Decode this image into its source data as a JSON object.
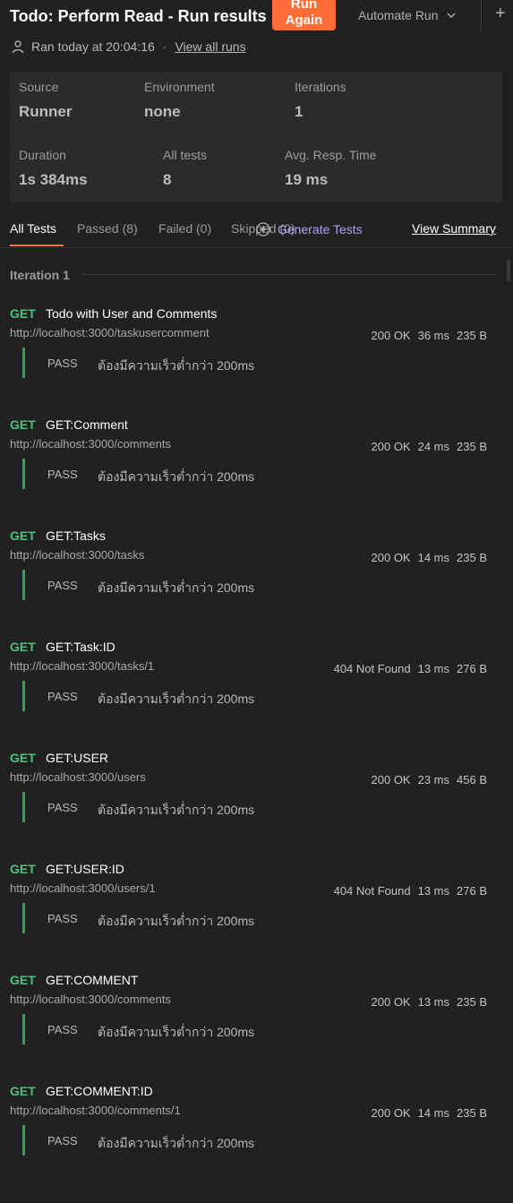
{
  "header": {
    "title": "Todo: Perform Read - Run results",
    "run_again_label": "Run\nAgain",
    "automate_label": "Automate Run",
    "ran_at": "Ran today at 20:04:16",
    "separator": "·",
    "view_all_runs": "View all runs",
    "plus": "+"
  },
  "summary": {
    "source_label": "Source",
    "source_value": "Runner",
    "environment_label": "Environment",
    "environment_value": "none",
    "iterations_label": "Iterations",
    "iterations_value": "1",
    "duration_label": "Duration",
    "duration_value": "1s 384ms",
    "all_tests_label": "All tests",
    "all_tests_value": "8",
    "avg_label": "Avg. Resp. Time",
    "avg_value": "19 ms"
  },
  "tabs": {
    "all": "All Tests",
    "passed": "Passed (8)",
    "failed": "Failed (0)",
    "skipped": "Skipped (0)",
    "generate": "Generate Tests",
    "view_summary": "View Summary"
  },
  "iteration_label": "Iteration 1",
  "colors": {
    "accent": "#ff6c37",
    "get": "#44c77c",
    "pass_bar": "#2da44e",
    "generate": "#b89cf5"
  },
  "requests": [
    {
      "method": "GET",
      "name": "Todo with User and Comments",
      "url": "http://localhost:3000/taskusercomment",
      "status": "200 OK",
      "time": "36 ms",
      "size": "235 B",
      "test_status": "PASS",
      "test_name": "ต้องมีความเร็วต่ำกว่า 200ms"
    },
    {
      "method": "GET",
      "name": "GET:Comment",
      "url": "http://localhost:3000/comments",
      "status": "200 OK",
      "time": "24 ms",
      "size": "235 B",
      "test_status": "PASS",
      "test_name": "ต้องมีความเร็วต่ำกว่า 200ms"
    },
    {
      "method": "GET",
      "name": "GET:Tasks",
      "url": "http://localhost:3000/tasks",
      "status": "200 OK",
      "time": "14 ms",
      "size": "235 B",
      "test_status": "PASS",
      "test_name": "ต้องมีความเร็วต่ำกว่า 200ms"
    },
    {
      "method": "GET",
      "name": "GET:Task:ID",
      "url": "http://localhost:3000/tasks/1",
      "status": "404 Not Found",
      "time": "13 ms",
      "size": "276 B",
      "test_status": "PASS",
      "test_name": "ต้องมีความเร็วต่ำกว่า 200ms"
    },
    {
      "method": "GET",
      "name": "GET:USER",
      "url": "http://localhost:3000/users",
      "status": "200 OK",
      "time": "23 ms",
      "size": "456 B",
      "test_status": "PASS",
      "test_name": "ต้องมีความเร็วต่ำกว่า 200ms"
    },
    {
      "method": "GET",
      "name": "GET:USER:ID",
      "url": "http://localhost:3000/users/1",
      "status": "404 Not Found",
      "time": "13 ms",
      "size": "276 B",
      "test_status": "PASS",
      "test_name": "ต้องมีความเร็วต่ำกว่า 200ms"
    },
    {
      "method": "GET",
      "name": "GET:COMMENT",
      "url": "http://localhost:3000/comments",
      "status": "200 OK",
      "time": "13 ms",
      "size": "235 B",
      "test_status": "PASS",
      "test_name": "ต้องมีความเร็วต่ำกว่า 200ms"
    },
    {
      "method": "GET",
      "name": "GET:COMMENT:ID",
      "url": "http://localhost:3000/comments/1",
      "status": "200 OK",
      "time": "14 ms",
      "size": "235 B",
      "test_status": "PASS",
      "test_name": "ต้องมีความเร็วต่ำกว่า 200ms"
    }
  ]
}
